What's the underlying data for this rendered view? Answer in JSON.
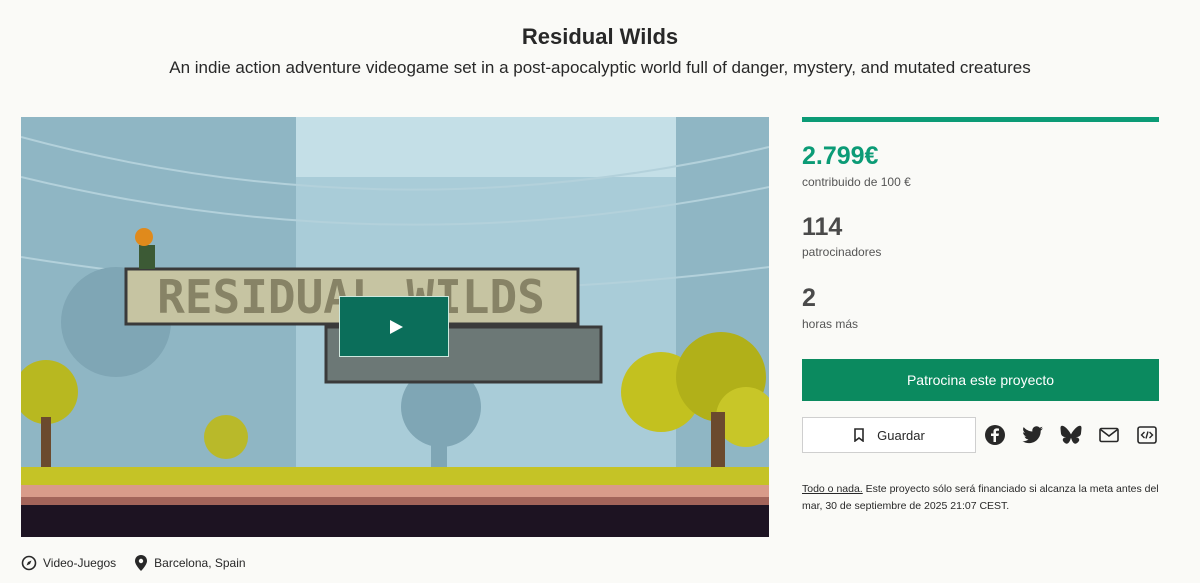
{
  "project": {
    "title": "Residual Wilds",
    "subtitle": "An indie action adventure videogame set in a post-apocalyptic world full of danger, mystery, and mutated creatures",
    "video_logo_text": "RESIDUAL WILDS"
  },
  "meta": {
    "category": "Video-Juegos",
    "location": "Barcelona, Spain",
    "category_icon": "compass-icon",
    "location_icon": "map-pin-icon"
  },
  "funding": {
    "progress_fraction": 1.0,
    "amount": "2.799€",
    "amount_label": "contribuido de 100 €",
    "backers": "114",
    "backers_label": "patrocinadores",
    "time_left": "2",
    "time_left_label": "horas más",
    "accent_color": "#0b9b76"
  },
  "actions": {
    "cta_label": "Patrocina este proyecto",
    "save_label": "Guardar",
    "share_icons": [
      "facebook-icon",
      "twitter-icon",
      "bluesky-icon",
      "email-icon",
      "embed-icon"
    ]
  },
  "note": {
    "link_text": "Todo o nada.",
    "text": " Este proyecto sólo será financiado si alcanza la meta antes del mar, 30 de septiembre de 2025 21:07 CEST."
  }
}
